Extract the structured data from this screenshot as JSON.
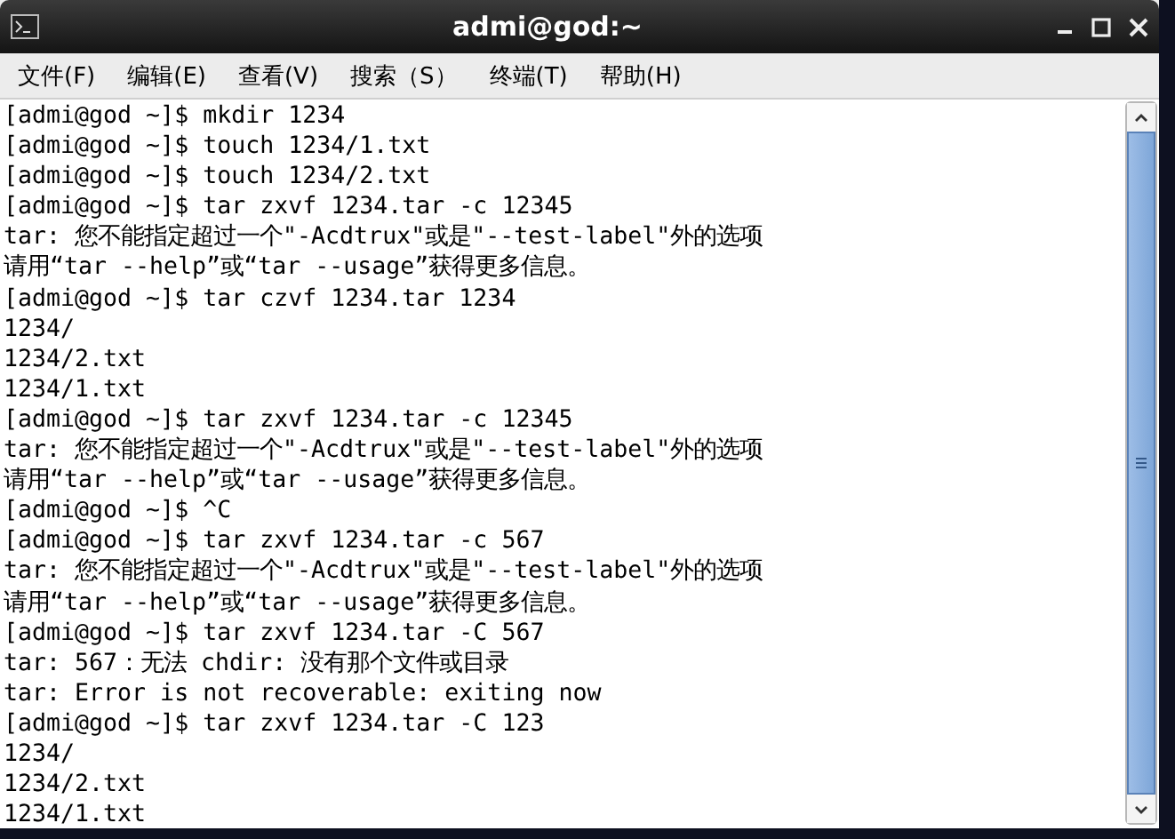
{
  "window": {
    "title": "admi@god:~"
  },
  "menu": [
    "文件(F)",
    "编辑(E)",
    "查看(V)",
    "搜索（S）",
    "终端(T)",
    "帮助(H)"
  ],
  "terminal": {
    "lines": [
      "[admi@god ~]$ mkdir 1234",
      "[admi@god ~]$ touch 1234/1.txt",
      "[admi@god ~]$ touch 1234/2.txt",
      "[admi@god ~]$ tar zxvf 1234.tar -c 12345",
      "tar: 您不能指定超过一个\"-Acdtrux\"或是\"--test-label\"外的选项",
      "请用“tar --help”或“tar --usage”获得更多信息。",
      "[admi@god ~]$ tar czvf 1234.tar 1234",
      "1234/",
      "1234/2.txt",
      "1234/1.txt",
      "[admi@god ~]$ tar zxvf 1234.tar -c 12345",
      "tar: 您不能指定超过一个\"-Acdtrux\"或是\"--test-label\"外的选项",
      "请用“tar --help”或“tar --usage”获得更多信息。",
      "[admi@god ~]$ ^C",
      "[admi@god ~]$ tar zxvf 1234.tar -c 567",
      "tar: 您不能指定超过一个\"-Acdtrux\"或是\"--test-label\"外的选项",
      "请用“tar --help”或“tar --usage”获得更多信息。",
      "[admi@god ~]$ tar zxvf 1234.tar -C 567",
      "tar: 567：无法 chdir: 没有那个文件或目录",
      "tar: Error is not recoverable: exiting now",
      "[admi@god ~]$ tar zxvf 1234.tar -C 123",
      "1234/",
      "1234/2.txt",
      "1234/1.txt"
    ]
  }
}
